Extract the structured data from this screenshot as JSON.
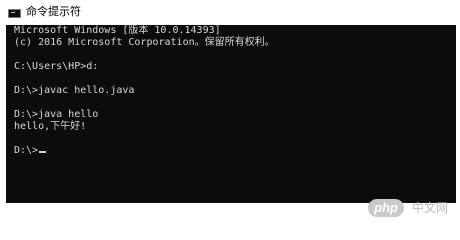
{
  "window": {
    "title": "命令提示符",
    "icon": "console-icon"
  },
  "console": {
    "lines": [
      "Microsoft Windows [版本 10.0.14393]",
      "(c) 2016 Microsoft Corporation。保留所有权利。",
      "",
      "C:\\Users\\HP>d:",
      "",
      "D:\\>javac hello.java",
      "",
      "D:\\>java hello",
      "hello,下午好!",
      "",
      "D:\\>"
    ],
    "colors": {
      "background": "#0c0c0c",
      "text": "#d8d8d8"
    }
  },
  "watermark": {
    "logo": "php",
    "text": "中文网"
  }
}
